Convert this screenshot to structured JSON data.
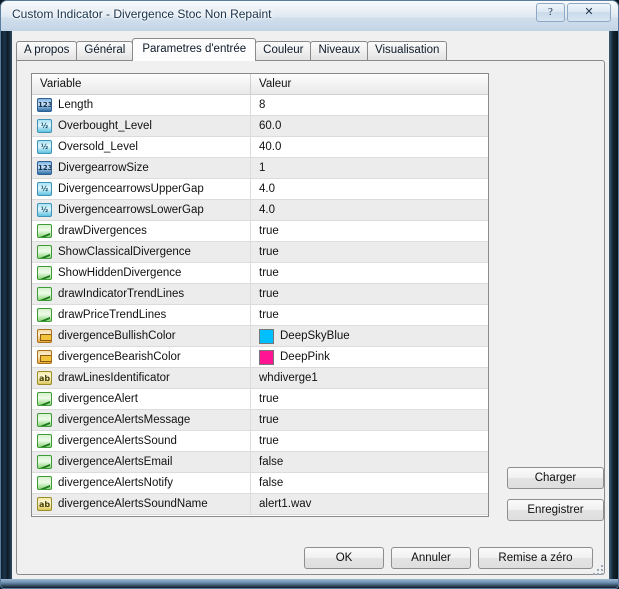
{
  "window": {
    "title": "Custom Indicator - Divergence Stoc Non Repaint",
    "help_label": "?",
    "close_label": "✕"
  },
  "tabs": [
    {
      "label": "A propos",
      "active": false
    },
    {
      "label": "Général",
      "active": false
    },
    {
      "label": "Parametres d'entrée",
      "active": true
    },
    {
      "label": "Couleur",
      "active": false
    },
    {
      "label": "Niveaux",
      "active": false
    },
    {
      "label": "Visualisation",
      "active": false
    }
  ],
  "grid": {
    "columns": [
      "Variable",
      "Valeur"
    ],
    "rows": [
      {
        "icon": "integer-icon",
        "icon_text": "123",
        "type": "int",
        "name": "Length",
        "value": "8"
      },
      {
        "icon": "double-icon",
        "icon_text": "½",
        "type": "dbl",
        "name": "Overbought_Level",
        "value": "60.0"
      },
      {
        "icon": "double-icon",
        "icon_text": "½",
        "type": "dbl",
        "name": "Oversold_Level",
        "value": "40.0"
      },
      {
        "icon": "integer-icon",
        "icon_text": "123",
        "type": "int",
        "name": "DivergearrowSize",
        "value": "1"
      },
      {
        "icon": "double-icon",
        "icon_text": "½",
        "type": "dbl",
        "name": "DivergencearrowsUpperGap",
        "value": "4.0"
      },
      {
        "icon": "double-icon",
        "icon_text": "½",
        "type": "dbl",
        "name": "DivergencearrowsLowerGap",
        "value": "4.0"
      },
      {
        "icon": "boolean-icon",
        "icon_text": "",
        "type": "bool",
        "name": "drawDivergences",
        "value": "true"
      },
      {
        "icon": "boolean-icon",
        "icon_text": "",
        "type": "bool",
        "name": "ShowClassicalDivergence",
        "value": "true"
      },
      {
        "icon": "boolean-icon",
        "icon_text": "",
        "type": "bool",
        "name": "ShowHiddenDivergence",
        "value": "true"
      },
      {
        "icon": "boolean-icon",
        "icon_text": "",
        "type": "bool",
        "name": "drawIndicatorTrendLines",
        "value": "true"
      },
      {
        "icon": "boolean-icon",
        "icon_text": "",
        "type": "bool",
        "name": "drawPriceTrendLines",
        "value": "true"
      },
      {
        "icon": "color-icon",
        "icon_text": "",
        "type": "color",
        "name": "divergenceBullishColor",
        "value": "DeepSkyBlue",
        "swatch": "#00BFFF"
      },
      {
        "icon": "color-icon",
        "icon_text": "",
        "type": "color",
        "name": "divergenceBearishColor",
        "value": "DeepPink",
        "swatch": "#FF1493"
      },
      {
        "icon": "string-icon",
        "icon_text": "ab",
        "type": "str",
        "name": "drawLinesIdentificator",
        "value": "whdiverge1"
      },
      {
        "icon": "boolean-icon",
        "icon_text": "",
        "type": "bool",
        "name": "divergenceAlert",
        "value": "true"
      },
      {
        "icon": "boolean-icon",
        "icon_text": "",
        "type": "bool",
        "name": "divergenceAlertsMessage",
        "value": "true"
      },
      {
        "icon": "boolean-icon",
        "icon_text": "",
        "type": "bool",
        "name": "divergenceAlertsSound",
        "value": "true"
      },
      {
        "icon": "boolean-icon",
        "icon_text": "",
        "type": "bool",
        "name": "divergenceAlertsEmail",
        "value": "false"
      },
      {
        "icon": "boolean-icon",
        "icon_text": "",
        "type": "bool",
        "name": "divergenceAlertsNotify",
        "value": "false"
      },
      {
        "icon": "string-icon",
        "icon_text": "ab",
        "type": "str",
        "name": "divergenceAlertsSoundName",
        "value": "alert1.wav"
      }
    ]
  },
  "side_buttons": {
    "charger": "Charger",
    "enregistrer": "Enregistrer"
  },
  "bottom_buttons": {
    "ok": "OK",
    "cancel": "Annuler",
    "reset": "Remise a zéro"
  }
}
